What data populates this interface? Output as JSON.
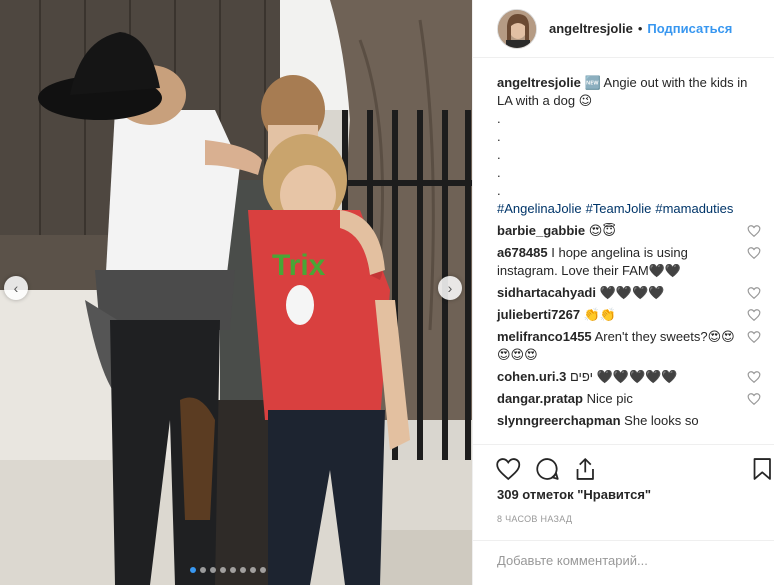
{
  "post": {
    "username": "angeltresjolie",
    "follow_label": "Подписаться",
    "separator": "•"
  },
  "caption": {
    "username": "angeltresjolie",
    "text": "🆕 Angie out with the kids in LA with a dog 😉",
    "dots": [
      ".",
      ".",
      ".",
      ".",
      "."
    ],
    "hashtags": [
      "#AngelinaJolie",
      "#TeamJolie",
      "#mamaduties"
    ]
  },
  "comments": [
    {
      "username": "barbie_gabbie",
      "text": "😍😇"
    },
    {
      "username": "a678485",
      "text": "I hope angelina is using instagram. Love their FAM🖤🖤"
    },
    {
      "username": "sidhartacahyadi",
      "text": "🖤🖤🖤🖤"
    },
    {
      "username": "julieberti7267",
      "text": "👏👏"
    },
    {
      "username": "melifranco1455",
      "text": "Aren't they sweets?😍😍😍😍😍"
    },
    {
      "username": "cohen.uri.3",
      "text": "יפים 🖤🖤🖤🖤🖤"
    },
    {
      "username": "dangar.pratap",
      "text": "Nice pic"
    },
    {
      "username": "slynngreerchapman",
      "text": "She looks so"
    }
  ],
  "likes": "309 отметок \"Нравится\"",
  "time": "8 ЧАСОВ НАЗАД",
  "add_comment_placeholder": "Добавьте комментарий...",
  "photo": {
    "shirt_text": "Trix",
    "carousel_total": 8,
    "carousel_active": 0
  },
  "icons": {
    "prev": "chevron-left-icon",
    "next": "chevron-right-icon",
    "like": "heart-icon",
    "comment": "comment-bubble-icon",
    "share": "share-icon",
    "save": "bookmark-icon"
  },
  "colors": {
    "link": "#3897f0",
    "hashtag": "#003569",
    "shirt_red": "#d9403f",
    "trix_green": "#49a636"
  }
}
